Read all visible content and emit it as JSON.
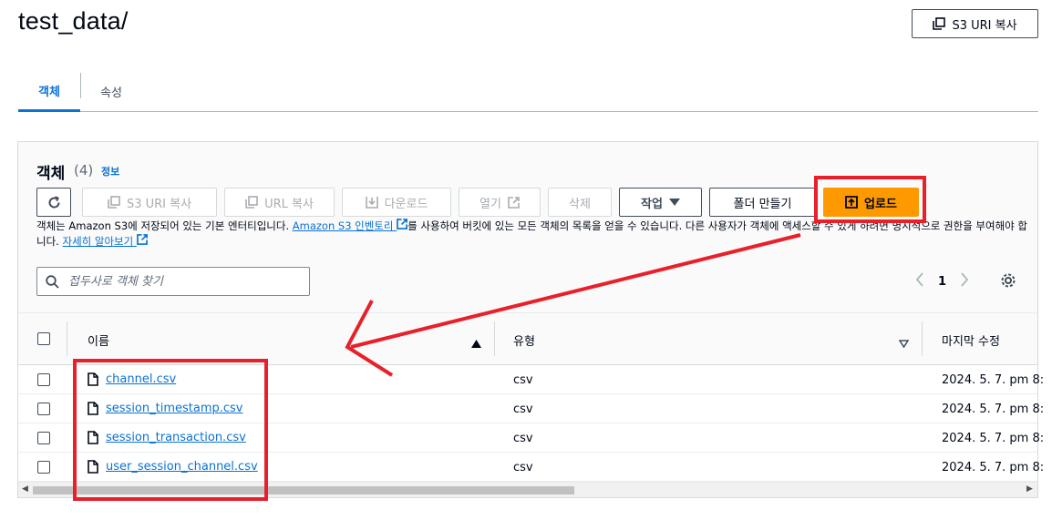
{
  "header": {
    "title": "test_data/",
    "copy_s3_uri_label": "S3 URI 복사"
  },
  "tabs": [
    {
      "label": "객체"
    },
    {
      "label": "속성"
    }
  ],
  "objects": {
    "title": "객체",
    "count": "(4)",
    "info_link": "정보",
    "toolbar": {
      "copy_s3_uri": "S3 URI 복사",
      "copy_url": "URL 복사",
      "download": "다운로드",
      "open": "열기",
      "delete": "삭제",
      "actions": "작업",
      "create_folder": "폴더 만들기",
      "upload": "업로드"
    },
    "description": {
      "part1": "객체는 Amazon S3에 저장되어 있는 기본 엔터티입니다. ",
      "inventory_link": "Amazon S3 인벤토리",
      "part2": "를 사용하여 버킷에 있는 모든 객체의 목록을 얻을 수 있습니다. 다른 사용자가 객체에 액세스할 수 있게 하려면 명시적으로 권한을 부여해야 합니다. ",
      "learn_more": "자세히 알아보기"
    },
    "search": {
      "placeholder": "접두사로 객체 찾기"
    },
    "pagination": {
      "page": "1"
    },
    "table": {
      "columns": {
        "name": "이름",
        "type": "유형",
        "modified": "마지막 수정"
      },
      "rows": [
        {
          "name": "channel.csv",
          "type": "csv",
          "modified": "2024. 5. 7. pm 8:"
        },
        {
          "name": "session_timestamp.csv",
          "type": "csv",
          "modified": "2024. 5. 7. pm 8:"
        },
        {
          "name": "session_transaction.csv",
          "type": "csv",
          "modified": "2024. 5. 7. pm 8:"
        },
        {
          "name": "user_session_channel.csv",
          "type": "csv",
          "modified": "2024. 5. 7. pm 8:"
        }
      ]
    }
  },
  "colors": {
    "accent": "#0972d3",
    "upload": "#ff9900",
    "annotation": "#e8202a"
  },
  "icons": [
    "copy-icon",
    "refresh-icon",
    "download-icon",
    "external-link-icon",
    "caret-down-icon",
    "upload-icon",
    "search-icon",
    "chevron-left-icon",
    "chevron-right-icon",
    "gear-icon",
    "sort-asc-icon",
    "sort-desc-icon",
    "file-icon"
  ]
}
